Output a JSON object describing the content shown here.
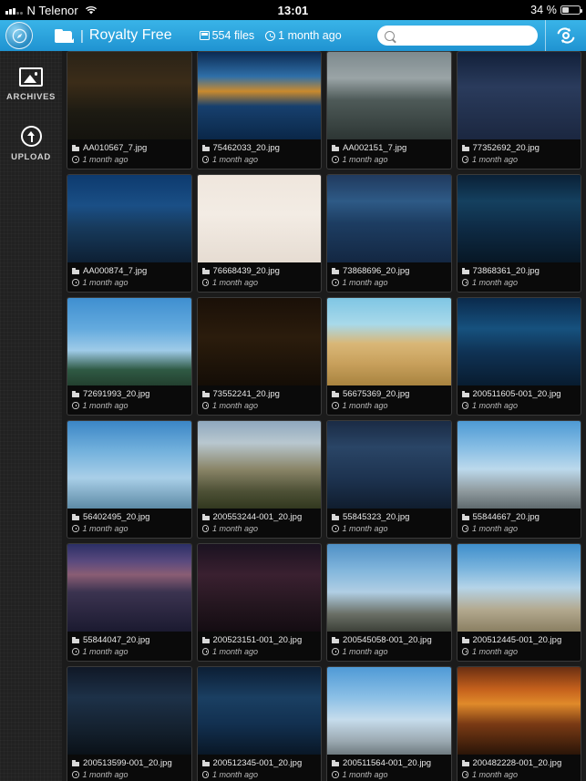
{
  "statusbar": {
    "carrier": "N Telenor",
    "time": "13:01",
    "battery": "34 %",
    "signal_icon": "signal-bars-icon",
    "wifi_icon": "wifi-icon",
    "battery_icon": "battery-icon"
  },
  "toolbar": {
    "logo_icon": "app-logo-icon",
    "folder_icon": "folder-icon",
    "breadcrumb_separator": "|",
    "title": "Royalty Free",
    "file_count": "554 files",
    "modified": "1 month ago",
    "files_icon": "files-icon",
    "clock_icon": "clock-icon",
    "search_placeholder": "",
    "search_value": "",
    "search_icon": "search-icon",
    "sync_icon": "sync-icon",
    "accent_color": "#2ea5de"
  },
  "sidebar": {
    "items": [
      {
        "label": "ARCHIVES",
        "icon": "archives-image-icon"
      },
      {
        "label": "UPLOAD",
        "icon": "upload-arrow-icon"
      }
    ]
  },
  "grid": {
    "name_icon": "folder-small-icon",
    "time_icon": "clock-small-icon",
    "items": [
      {
        "name": "AA010567_7.jpg",
        "time": "1 month ago",
        "thumb": "temple-statue"
      },
      {
        "name": "75462033_20.jpg",
        "time": "1 month ago",
        "thumb": "city-night-water"
      },
      {
        "name": "AA002151_7.jpg",
        "time": "1 month ago",
        "thumb": "taj-mahal"
      },
      {
        "name": "77352692_20.jpg",
        "time": "1 month ago",
        "thumb": "times-square"
      },
      {
        "name": "AA000874_7.jpg",
        "time": "1 month ago",
        "thumb": "colosseum"
      },
      {
        "name": "76668439_20.jpg",
        "time": "1 month ago",
        "thumb": "golden-gate-fog"
      },
      {
        "name": "73868696_20.jpg",
        "time": "1 month ago",
        "thumb": "venice-gondola"
      },
      {
        "name": "73868361_20.jpg",
        "time": "1 month ago",
        "thumb": "brooklyn-bridge"
      },
      {
        "name": "72691993_20.jpg",
        "time": "1 month ago",
        "thumb": "cn-tower-sky"
      },
      {
        "name": "73552241_20.jpg",
        "time": "1 month ago",
        "thumb": "tv-tower-night"
      },
      {
        "name": "56675369_20.jpg",
        "time": "1 month ago",
        "thumb": "pyramids-desert"
      },
      {
        "name": "200511605-001_20.jpg",
        "time": "1 month ago",
        "thumb": "tower-bridge-night"
      },
      {
        "name": "56402495_20.jpg",
        "time": "1 month ago",
        "thumb": "statue-of-liberty"
      },
      {
        "name": "200553244-001_20.jpg",
        "time": "1 month ago",
        "thumb": "mayan-pyramid"
      },
      {
        "name": "55845323_20.jpg",
        "time": "1 month ago",
        "thumb": "church-spilled-blood"
      },
      {
        "name": "55844667_20.jpg",
        "time": "1 month ago",
        "thumb": "cathedral-blue-sky"
      },
      {
        "name": "55844047_20.jpg",
        "time": "1 month ago",
        "thumb": "city-dusk-mountain"
      },
      {
        "name": "200523151-001_20.jpg",
        "time": "1 month ago",
        "thumb": "tokyo-street-night"
      },
      {
        "name": "200545058-001_20.jpg",
        "time": "1 month ago",
        "thumb": "big-ben"
      },
      {
        "name": "200512445-001_20.jpg",
        "time": "1 month ago",
        "thumb": "parthenon"
      },
      {
        "name": "200513599-001_20.jpg",
        "time": "1 month ago",
        "thumb": "city-light-trails"
      },
      {
        "name": "200512345-001_20.jpg",
        "time": "1 month ago",
        "thumb": "bridge-night-blue"
      },
      {
        "name": "200511564-001_20.jpg",
        "time": "1 month ago",
        "thumb": "london-eye-clouds"
      },
      {
        "name": "200482228-001_20.jpg",
        "time": "1 month ago",
        "thumb": "sunset-sea-rocks"
      }
    ]
  }
}
